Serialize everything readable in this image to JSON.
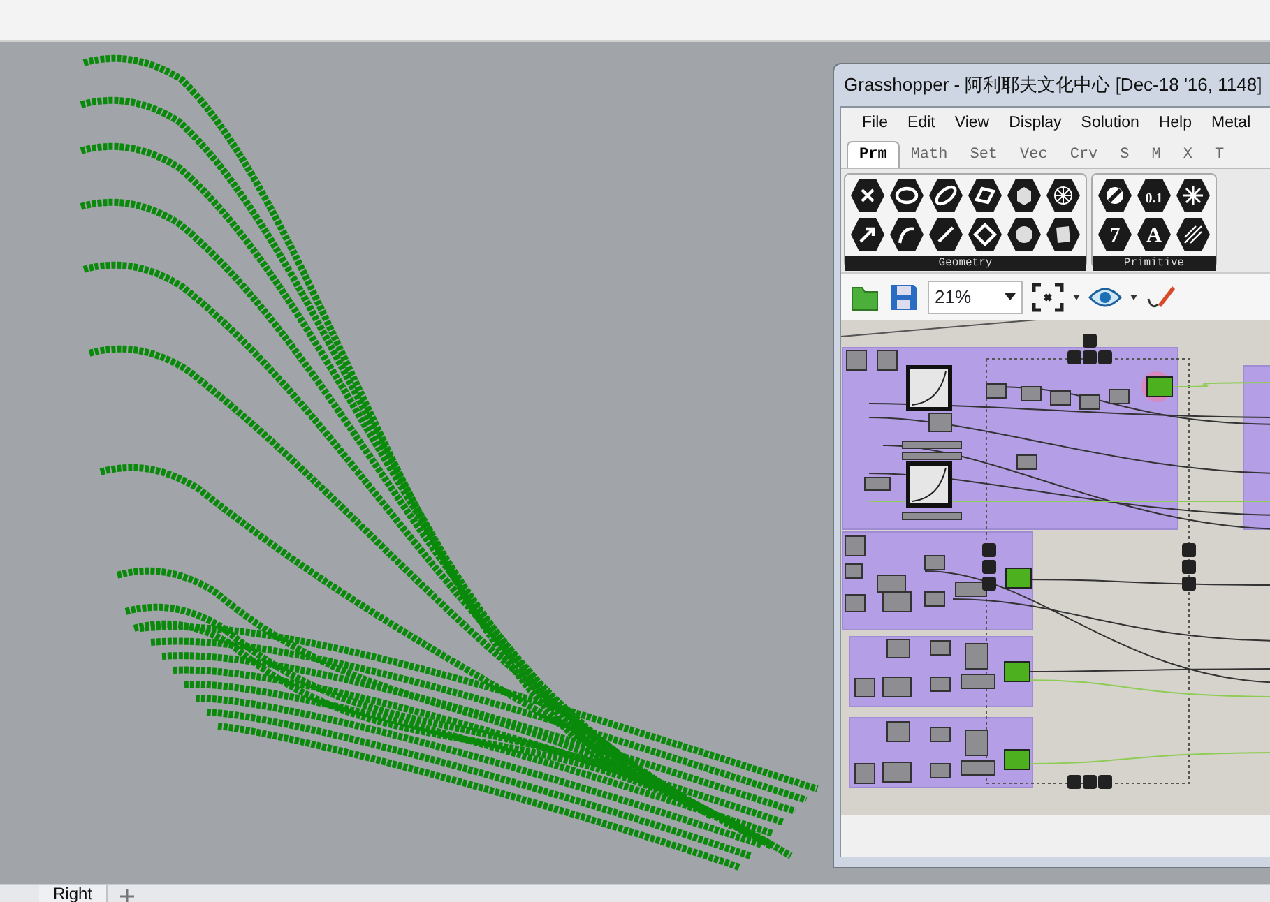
{
  "viewport": {
    "tabs": [
      {
        "label": "Right"
      }
    ]
  },
  "grasshopper": {
    "title": "Grasshopper - 阿利耶夫文化中心 [Dec-18 '16, 1148]",
    "menus": [
      "File",
      "Edit",
      "View",
      "Display",
      "Solution",
      "Help",
      "Metal"
    ],
    "tabs": [
      {
        "label": "Prm",
        "selected": true
      },
      {
        "label": "Math",
        "selected": false
      },
      {
        "label": "Set",
        "selected": false
      },
      {
        "label": "Vec",
        "selected": false
      },
      {
        "label": "Crv",
        "selected": false
      },
      {
        "label": "S",
        "selected": false
      },
      {
        "label": "M",
        "selected": false
      },
      {
        "label": "X",
        "selected": false
      },
      {
        "label": "T",
        "selected": false
      }
    ],
    "ribbon_groups": [
      {
        "label": "Geometry"
      },
      {
        "label": "Primitive",
        "glyphs": [
          "0.1",
          "7",
          "A"
        ]
      }
    ],
    "zoom": {
      "value": "21%"
    }
  }
}
